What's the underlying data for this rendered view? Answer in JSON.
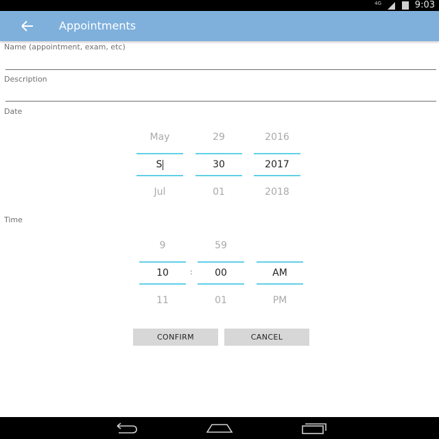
{
  "status_bar": {
    "network": "4G",
    "time": "9:03"
  },
  "app_bar": {
    "title": "Appointments",
    "back_icon": "arrow-left-icon"
  },
  "form": {
    "name_label": "Name (appointment, exam, etc)",
    "name_value": "",
    "description_label": "Description",
    "description_value": "",
    "date_label": "Date",
    "time_label": "Time"
  },
  "date_picker": {
    "month": {
      "prev": "May",
      "current": "S",
      "next": "Jul"
    },
    "day": {
      "prev": "29",
      "current": "30",
      "next": "01"
    },
    "year": {
      "prev": "2016",
      "current": "2017",
      "next": "2018"
    }
  },
  "time_picker": {
    "hour": {
      "prev": "9",
      "current": "10",
      "next": "11"
    },
    "separator": ":",
    "minute": {
      "prev": "59",
      "current": "00",
      "next": "01"
    },
    "ampm": {
      "prev": "",
      "current": "AM",
      "next": "PM"
    }
  },
  "buttons": {
    "confirm": "CONFIRM",
    "cancel": "CANCEL"
  },
  "colors": {
    "app_bar": "#7fb0dc",
    "picker_divider": "#5fd0e8",
    "button_bg": "#d7d7d7"
  },
  "nav_bar": {
    "icons": [
      "back-icon",
      "home-icon",
      "recents-icon"
    ]
  }
}
